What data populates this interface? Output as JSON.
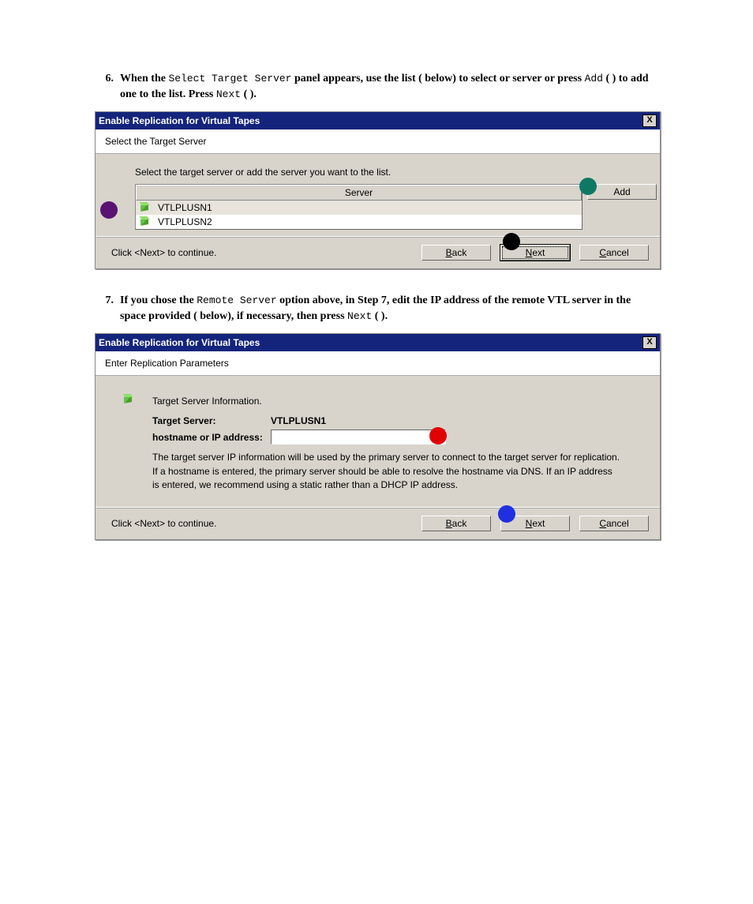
{
  "step6": {
    "num": "6.",
    "t1": "When the ",
    "m1": "Select Target Server",
    "t2": " panel appears, use the list (   below) to select or server or press ",
    "m2": "Add",
    "t3": " (  ) to add one to the list. Press ",
    "m3": "Next",
    "t4": " (  )."
  },
  "step7": {
    "num": "7.",
    "t1": "If you chose the ",
    "m1": "Remote Server",
    "t2": " option above, in Step 7, edit the IP address of the remote VTL server in the space provided (   below), if necessary, then press ",
    "m2": "Next",
    "t3": " (  )."
  },
  "dlg1": {
    "title": "Enable Replication for Virtual Tapes",
    "close": "X",
    "white": "Select the Target Server",
    "instr": "Select the target server or add the server you want to the list.",
    "colhdr": "Server",
    "rows": [
      "VTLPLUSN1",
      "VTLPLUSN2"
    ],
    "add": "Add",
    "hint": "Click <Next> to continue.",
    "back_u": "B",
    "back_r": "ack",
    "next_u": "N",
    "next_r": "ext",
    "cancel_u": "C",
    "cancel_r": "ancel"
  },
  "dlg2": {
    "title": "Enable Replication for Virtual Tapes",
    "close": "X",
    "white": "Enter Replication Parameters",
    "section": "Target Server Information.",
    "ts_lbl": "Target Server:",
    "ts_val": "VTLPLUSN1",
    "ip_lbl": "hostname or IP address:",
    "desc": "The target server IP information will be used by the primary server to connect to the target server for replication. If a hostname is entered, the primary server should be able to resolve the hostname via DNS. If an IP address is entered, we recommend using a static rather than a DHCP IP address.",
    "hint": "Click <Next> to continue.",
    "back_u": "B",
    "back_r": "ack",
    "next_u": "N",
    "next_r": "ext",
    "cancel_u": "C",
    "cancel_r": "ancel"
  }
}
